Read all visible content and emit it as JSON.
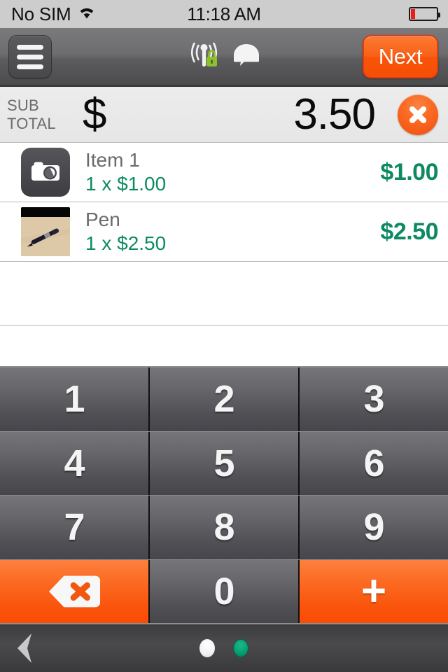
{
  "status_bar": {
    "carrier": "No SIM",
    "wifi_icon": "wifi-icon",
    "time": "11:18 AM",
    "battery_icon": "battery-icon",
    "battery_level_percent": 12
  },
  "nav_bar": {
    "menu_icon": "hamburger-menu-icon",
    "broadcast_icon": "antenna-broadcast-secure-icon",
    "chat_icon": "speech-bubble-icon",
    "next_label": "Next",
    "accent_color": "#f95f14"
  },
  "subtotal": {
    "label_line1": "SUB",
    "label_line2": "TOTAL",
    "currency_symbol": "$",
    "amount": "3.50",
    "clear_icon": "close-x-icon",
    "clear_color": "#f75e14"
  },
  "cart": {
    "price_color": "#0e8a62",
    "items": [
      {
        "name": "Item 1",
        "quantity_line": "1 x $1.00",
        "total": "$1.00",
        "thumb_type": "camera-placeholder"
      },
      {
        "name": "Pen",
        "quantity_line": "1 x $2.50",
        "total": "$2.50",
        "thumb_type": "photo"
      }
    ],
    "empty_row_count": 2
  },
  "keypad": {
    "rows": [
      [
        {
          "label": "1",
          "name": "key-1",
          "style": "digit"
        },
        {
          "label": "2",
          "name": "key-2",
          "style": "digit"
        },
        {
          "label": "3",
          "name": "key-3",
          "style": "digit"
        }
      ],
      [
        {
          "label": "4",
          "name": "key-4",
          "style": "digit"
        },
        {
          "label": "5",
          "name": "key-5",
          "style": "digit"
        },
        {
          "label": "6",
          "name": "key-6",
          "style": "digit"
        }
      ],
      [
        {
          "label": "7",
          "name": "key-7",
          "style": "digit"
        },
        {
          "label": "8",
          "name": "key-8",
          "style": "digit"
        },
        {
          "label": "9",
          "name": "key-9",
          "style": "digit"
        }
      ],
      [
        {
          "label": "",
          "name": "key-backspace",
          "style": "accent-backspace",
          "icon": "backspace-delete-icon"
        },
        {
          "label": "0",
          "name": "key-0",
          "style": "digit"
        },
        {
          "label": "+",
          "name": "key-plus",
          "style": "accent-plus",
          "icon": "plus-icon"
        }
      ]
    ],
    "accent_color": "#fa5b12"
  },
  "bottom_bar": {
    "back_icon": "chevron-left-icon",
    "page_dots": [
      {
        "name": "page-dot-1",
        "state": "inactive",
        "color": "#ffffff"
      },
      {
        "name": "page-dot-2",
        "state": "active",
        "color": "#08a073"
      }
    ]
  }
}
